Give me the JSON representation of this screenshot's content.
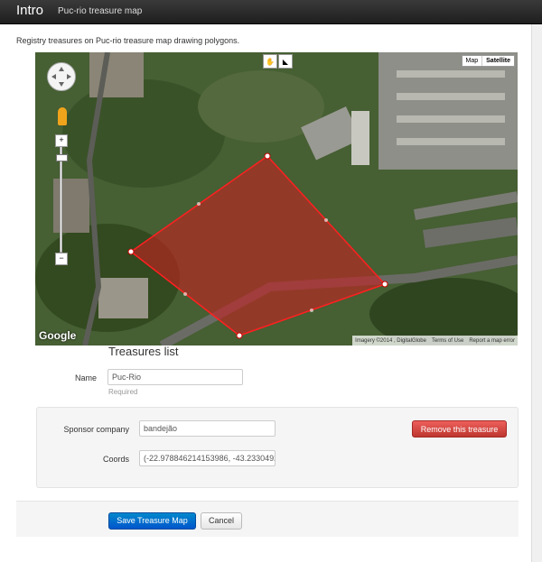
{
  "navbar": {
    "brand": "Intro",
    "link": "Puc-rio treasure map"
  },
  "intro_text": "Registry treasures on Puc-rio treasure map drawing polygons.",
  "map": {
    "type_options": [
      "Map",
      "Satellite"
    ],
    "active_type": "Satellite",
    "logo_text": "Google",
    "attribution": [
      "Imagery ©2014 , DigitalGlobe",
      "Terms of Use",
      "Report a map error"
    ],
    "zoom_in": "+",
    "zoom_out": "−",
    "polygon_color": "#cc2222"
  },
  "treasures_heading": "Treasures list",
  "form": {
    "name_label": "Name",
    "name_value": "Puc-Rio",
    "name_help": "Required",
    "sponsor_label": "Sponsor company",
    "sponsor_value": "bandejão",
    "coords_label": "Coords",
    "coords_value": "(-22.978846214153986, -43.2330492",
    "remove_button": "Remove this treasure"
  },
  "actions": {
    "save": "Save Treasure Map",
    "cancel": "Cancel"
  }
}
